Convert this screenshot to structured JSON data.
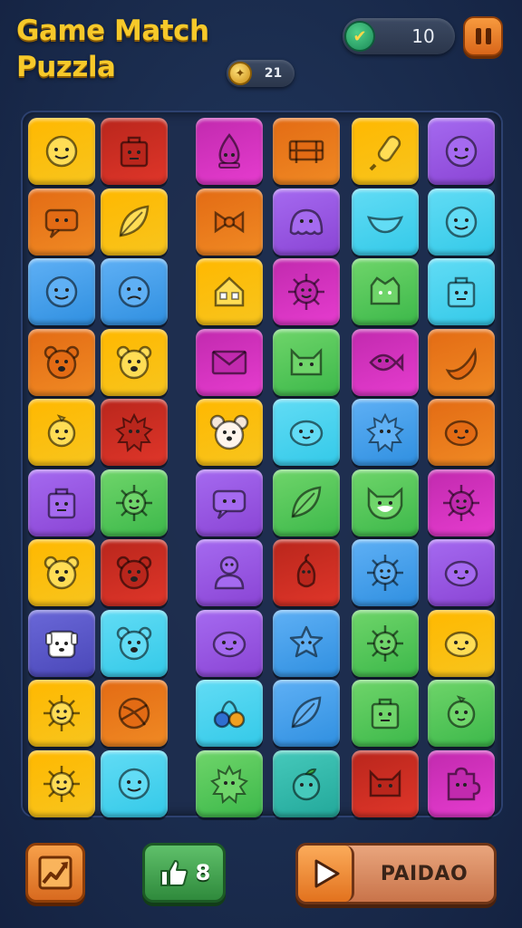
{
  "header": {
    "title_line1": "Game Match",
    "title_line2": "Puzzla",
    "score_value": "10",
    "coins_value": "21",
    "score_icon": "check-coin-icon",
    "coins_icon": "gold-coin-icon",
    "pause_icon": "pause-icon"
  },
  "board": {
    "rows": 10,
    "cols": 6,
    "tiles": [
      [
        "yellow",
        "face"
      ],
      [
        "red",
        "bag"
      ],
      [
        "magenta",
        "drop"
      ],
      [
        "orange",
        "bench"
      ],
      [
        "yellow",
        "popsicle"
      ],
      [
        "purple",
        "face"
      ],
      [
        "orange",
        "speech"
      ],
      [
        "yellow",
        "leaf"
      ],
      [
        "orange",
        "bow"
      ],
      [
        "purple",
        "ghost"
      ],
      [
        "cyan",
        "boat"
      ],
      [
        "cyan",
        "face"
      ],
      [
        "blue",
        "face"
      ],
      [
        "blue",
        "face-sad"
      ],
      [
        "yellow",
        "house"
      ],
      [
        "magenta",
        "sun"
      ],
      [
        "green",
        "monster"
      ],
      [
        "cyan",
        "bag"
      ],
      [
        "orange",
        "bear"
      ],
      [
        "yellow",
        "bear"
      ],
      [
        "magenta",
        "envelope"
      ],
      [
        "green",
        "cat"
      ],
      [
        "magenta",
        "fish"
      ],
      [
        "orange",
        "banana"
      ],
      [
        "yellow",
        "bird"
      ],
      [
        "red",
        "spiky"
      ],
      [
        "yellow",
        "mouse"
      ],
      [
        "cyan",
        "blob"
      ],
      [
        "blue",
        "spiky"
      ],
      [
        "orange",
        "blob"
      ],
      [
        "purple",
        "bag"
      ],
      [
        "green",
        "sun"
      ],
      [
        "purple",
        "speech"
      ],
      [
        "green",
        "leaf"
      ],
      [
        "green",
        "fox"
      ],
      [
        "magenta",
        "sun"
      ],
      [
        "yellow",
        "bear"
      ],
      [
        "red",
        "bear"
      ],
      [
        "purple",
        "person"
      ],
      [
        "red",
        "pepper"
      ],
      [
        "blue",
        "sun"
      ],
      [
        "purple",
        "blob"
      ],
      [
        "indigo",
        "dog"
      ],
      [
        "cyan",
        "bear"
      ],
      [
        "purple",
        "blob"
      ],
      [
        "blue",
        "star"
      ],
      [
        "green",
        "sun"
      ],
      [
        "yellow",
        "blob"
      ],
      [
        "yellow",
        "sun"
      ],
      [
        "orange",
        "ball"
      ],
      [
        "cyan",
        "berries"
      ],
      [
        "blue",
        "leaf"
      ],
      [
        "green",
        "bag"
      ],
      [
        "green",
        "bird"
      ],
      [
        "yellow",
        "sun"
      ],
      [
        "cyan",
        "face"
      ],
      [
        "green",
        "spiky"
      ],
      [
        "teal",
        "apple"
      ],
      [
        "red",
        "cat"
      ],
      [
        "magenta",
        "puzzle"
      ]
    ]
  },
  "palette": {
    "yellow": "#f7c51e",
    "red": "#e0362a",
    "magenta": "#e63ccf",
    "orange": "#f08a24",
    "purple": "#8a44d4",
    "cyan": "#33c9e8",
    "blue": "#2f8fe0",
    "green": "#3cb84a",
    "indigo": "#4a47b8",
    "teal": "#22a89a"
  },
  "controls": {
    "chart_icon": "chart-icon",
    "hint_icon": "thumbs-up-icon",
    "hint_count": "8",
    "play_icon": "play-icon",
    "play_label": "PAIDAO"
  }
}
